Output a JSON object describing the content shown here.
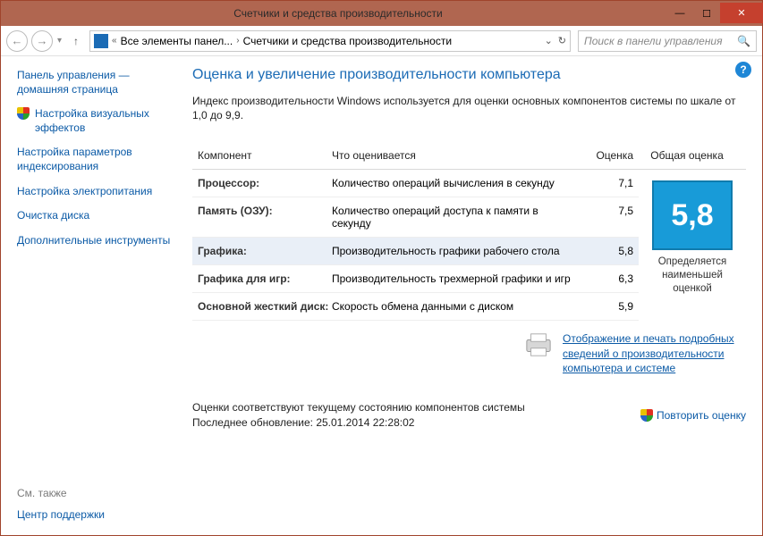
{
  "titlebar": {
    "title": "Счетчики и средства производительности"
  },
  "address": {
    "crumb1": "Все элементы панел...",
    "crumb2": "Счетчики и средства производительности"
  },
  "search": {
    "placeholder": "Поиск в панели управления"
  },
  "sidebar": {
    "home": "Панель управления — домашняя страница",
    "items": [
      "Настройка визуальных эффектов",
      "Настройка параметров индексирования",
      "Настройка электропитания",
      "Очистка диска",
      "Дополнительные инструменты"
    ],
    "see_also": "См. также",
    "support": "Центр поддержки"
  },
  "main": {
    "heading": "Оценка и увеличение производительности компьютера",
    "desc": "Индекс производительности Windows используется для оценки основных компонентов системы по шкале от 1,0 до 9,9.",
    "th": {
      "component": "Компонент",
      "what": "Что оценивается",
      "score": "Оценка",
      "base": "Общая оценка"
    },
    "rows": [
      {
        "c": "Процессор:",
        "w": "Количество операций вычисления в секунду",
        "s": "7,1"
      },
      {
        "c": "Память (ОЗУ):",
        "w": "Количество операций доступа к памяти в секунду",
        "s": "7,5"
      },
      {
        "c": "Графика:",
        "w": "Производительность графики рабочего стола",
        "s": "5,8"
      },
      {
        "c": "Графика для игр:",
        "w": "Производительность трехмерной графики и игр",
        "s": "6,3"
      },
      {
        "c": "Основной жесткий диск:",
        "w": "Скорость обмена данными с диском",
        "s": "5,9"
      }
    ],
    "base_score": "5,8",
    "base_caption": "Определяется наименьшей оценкой",
    "print_link": "Отображение и печать подробных сведений о производительности компьютера и системе",
    "footer1": "Оценки соответствуют текущему состоянию компонентов системы",
    "footer2": "Последнее обновление: 25.01.2014 22:28:02",
    "repeat": "Повторить оценку"
  }
}
